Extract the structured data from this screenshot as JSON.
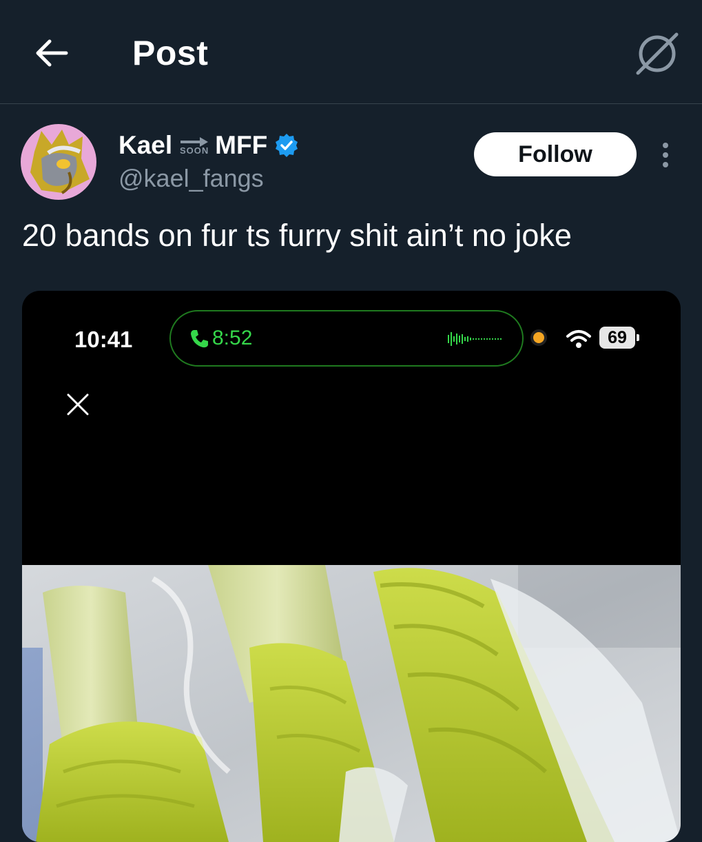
{
  "header": {
    "title": "Post",
    "back_icon": "arrow-left-icon",
    "grok_icon": "grok-icon"
  },
  "post": {
    "author": {
      "name_part1": "Kael",
      "name_soon": "SOON",
      "name_part2": "MFF",
      "handle": "@kael_fangs",
      "verified": true,
      "verified_color": "#1d9bf0"
    },
    "follow_label": "Follow",
    "text": "20 bands on fur ts furry shit ain’t no joke"
  },
  "media": {
    "status_time": "10:41",
    "call_time": "8:52",
    "battery": "69",
    "call_color": "#35d74a"
  },
  "colors": {
    "background": "#15202b",
    "divider": "#38444d",
    "secondary_text": "#8b98a5",
    "fur": "#b5c832"
  }
}
